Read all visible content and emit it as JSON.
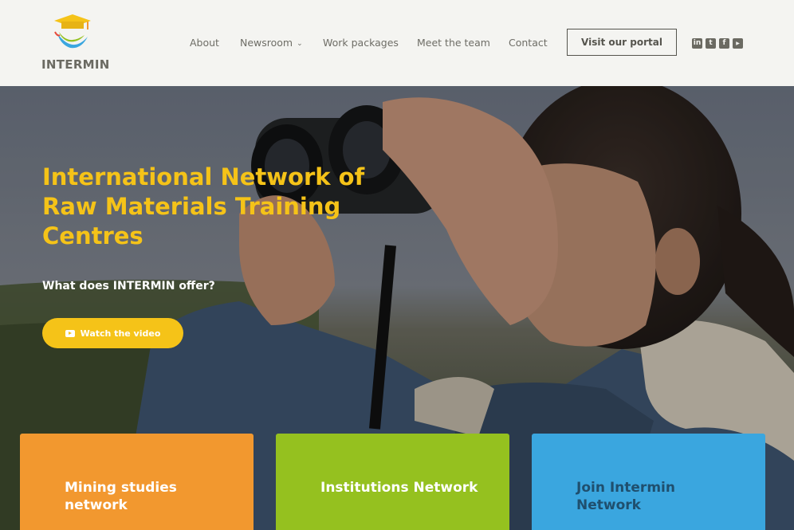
{
  "brand": {
    "logo_text": "INTERMIN"
  },
  "nav": {
    "items": [
      {
        "label": "About"
      },
      {
        "label": "Newsroom"
      },
      {
        "label": "Work packages"
      },
      {
        "label": "Meet the team"
      },
      {
        "label": "Contact"
      }
    ],
    "newsroom_chevron": "⌄",
    "portal_button": "Visit our portal"
  },
  "socials": [
    {
      "icon": "linkedin-icon",
      "glyph": "in"
    },
    {
      "icon": "twitter-icon",
      "glyph": "t"
    },
    {
      "icon": "facebook-icon",
      "glyph": "f"
    },
    {
      "icon": "youtube-icon",
      "glyph": "▶"
    }
  ],
  "hero": {
    "title": "International Network of Raw Materials Training Centres",
    "subtitle": "What does INTERMIN offer?",
    "video_button": "Watch the video",
    "video_icon": "youtube-play-icon"
  },
  "cards": [
    {
      "label": "Mining studies network",
      "color": "#f2982f"
    },
    {
      "label": "Institutions Network",
      "color": "#95c11f"
    },
    {
      "label": "Join Intermin Network",
      "color": "#3aa6df"
    }
  ],
  "colors": {
    "accent_yellow": "#f5c318",
    "header_bg": "#f4f4f1",
    "nav_text": "#6e6d66"
  }
}
